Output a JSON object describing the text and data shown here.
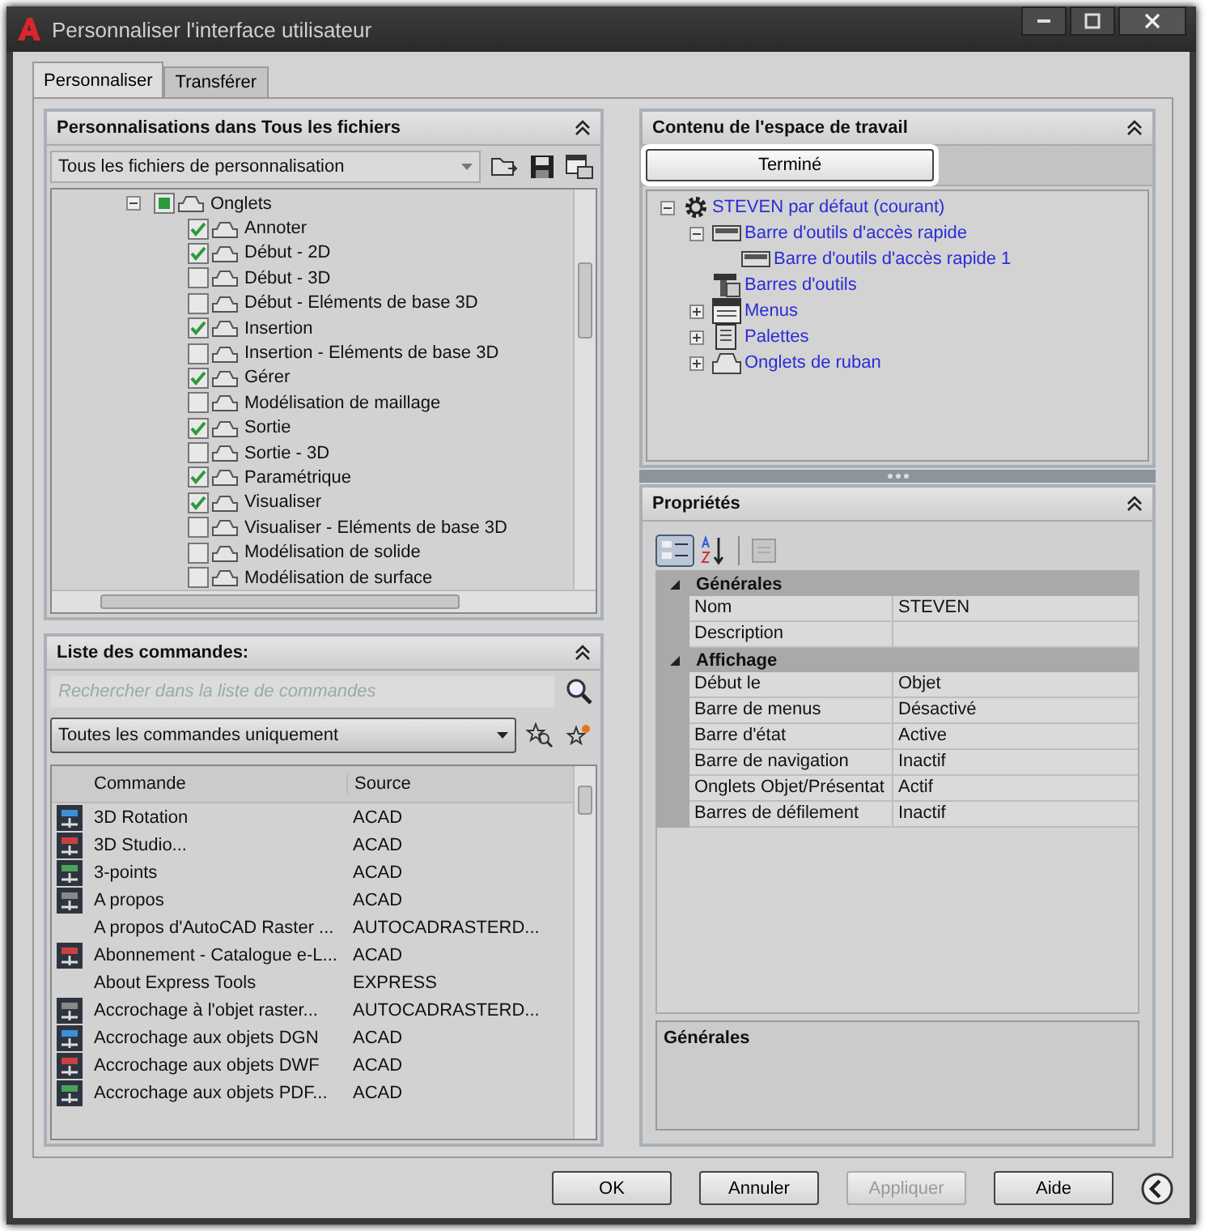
{
  "window": {
    "title": "Personnaliser l'interface utilisateur"
  },
  "tabs": [
    {
      "label": "Personnaliser",
      "selected": true
    },
    {
      "label": "Transférer",
      "selected": false
    }
  ],
  "customizations": {
    "title": "Personnalisations dans Tous les fichiers",
    "file_filter": "Tous les fichiers de personnalisation",
    "tree": [
      {
        "label": "Onglets",
        "checked": false,
        "partial": true,
        "expanded": true,
        "children": [
          {
            "label": "Annoter",
            "checked": true
          },
          {
            "label": "Début - 2D",
            "checked": true
          },
          {
            "label": "Début - 3D",
            "checked": false
          },
          {
            "label": "Début - Eléments de base 3D",
            "checked": false
          },
          {
            "label": "Insertion",
            "checked": true
          },
          {
            "label": "Insertion - Eléments de base 3D",
            "checked": false
          },
          {
            "label": "Gérer",
            "checked": true
          },
          {
            "label": "Modélisation de maillage",
            "checked": false
          },
          {
            "label": "Sortie",
            "checked": true
          },
          {
            "label": "Sortie - 3D",
            "checked": false
          },
          {
            "label": "Paramétrique",
            "checked": true
          },
          {
            "label": "Visualiser",
            "checked": true
          },
          {
            "label": "Visualiser - Eléments de base 3D",
            "checked": false
          },
          {
            "label": "Modélisation de solide",
            "checked": false
          },
          {
            "label": "Modélisation de surface",
            "checked": false
          }
        ]
      }
    ]
  },
  "commands": {
    "title": "Liste des commandes:",
    "search": {
      "placeholder": "Rechercher dans la liste de commandes"
    },
    "filter": "Toutes les commandes uniquement",
    "columns": [
      "Commande",
      "Source"
    ],
    "rows": [
      {
        "kind": "icon",
        "command": "3D Rotation",
        "source": "ACAD"
      },
      {
        "kind": "icon",
        "command": "3D Studio...",
        "source": "ACAD"
      },
      {
        "kind": "icon",
        "command": "3-points",
        "source": "ACAD"
      },
      {
        "kind": "icon",
        "command": "A propos",
        "source": "ACAD"
      },
      {
        "kind": "plain",
        "command": "A propos d'AutoCAD Raster ...",
        "source": "AUTOCADRASTERD..."
      },
      {
        "kind": "icon",
        "command": "Abonnement - Catalogue e-L...",
        "source": "ACAD"
      },
      {
        "kind": "plain",
        "command": "About Express Tools",
        "source": "EXPRESS"
      },
      {
        "kind": "icon",
        "command": "Accrochage à l'objet raster...",
        "source": "AUTOCADRASTERD..."
      },
      {
        "kind": "icon",
        "command": "Accrochage aux objets DGN",
        "source": "ACAD"
      },
      {
        "kind": "icon",
        "command": "Accrochage aux objets DWF",
        "source": "ACAD"
      },
      {
        "kind": "icon",
        "command": "Accrochage aux objets PDF...",
        "source": "ACAD"
      }
    ]
  },
  "workspace": {
    "title": "Contenu de l'espace de travail",
    "done_button": "Terminé",
    "tree": [
      {
        "label": "STEVEN par défaut (courant)",
        "kind": "gear",
        "expanded": true,
        "children": [
          {
            "label": "Barre d'outils d'accès rapide",
            "kind": "toolbar",
            "expanded": true,
            "children": [
              {
                "label": "Barre d'outils d'accès rapide 1",
                "kind": "toolbar"
              }
            ]
          },
          {
            "label": "Barres d'outils",
            "kind": "toolbars"
          },
          {
            "label": "Menus",
            "kind": "menus",
            "expanded": false
          },
          {
            "label": "Palettes",
            "kind": "palettes",
            "expanded": false
          },
          {
            "label": "Onglets de ruban",
            "kind": "ribbon",
            "expanded": false
          }
        ]
      }
    ]
  },
  "properties": {
    "title": "Propriétés",
    "groups": [
      {
        "name": "Générales",
        "expanded": true,
        "rows": [
          {
            "name": "Nom",
            "value": "STEVEN"
          },
          {
            "name": "Description"
          }
        ]
      },
      {
        "name": "Affichage",
        "expanded": true,
        "rows": [
          {
            "name": "Début le",
            "value": "Objet"
          },
          {
            "name": "Barre de menus",
            "value": "Désactivé"
          },
          {
            "name": "Barre d'état",
            "value": "Active"
          },
          {
            "name": "Barre de navigation",
            "value": "Inactif"
          },
          {
            "name": "Onglets Objet/Présentat",
            "value": "Actif"
          },
          {
            "name": "Barres de défilement",
            "value": "Inactif"
          }
        ]
      }
    ],
    "description_title": "Générales"
  },
  "buttons": [
    {
      "label": "OK",
      "disabled": false
    },
    {
      "label": "Annuler",
      "disabled": false
    },
    {
      "label": "Appliquer",
      "disabled": true
    },
    {
      "label": "Aide",
      "disabled": false
    }
  ]
}
